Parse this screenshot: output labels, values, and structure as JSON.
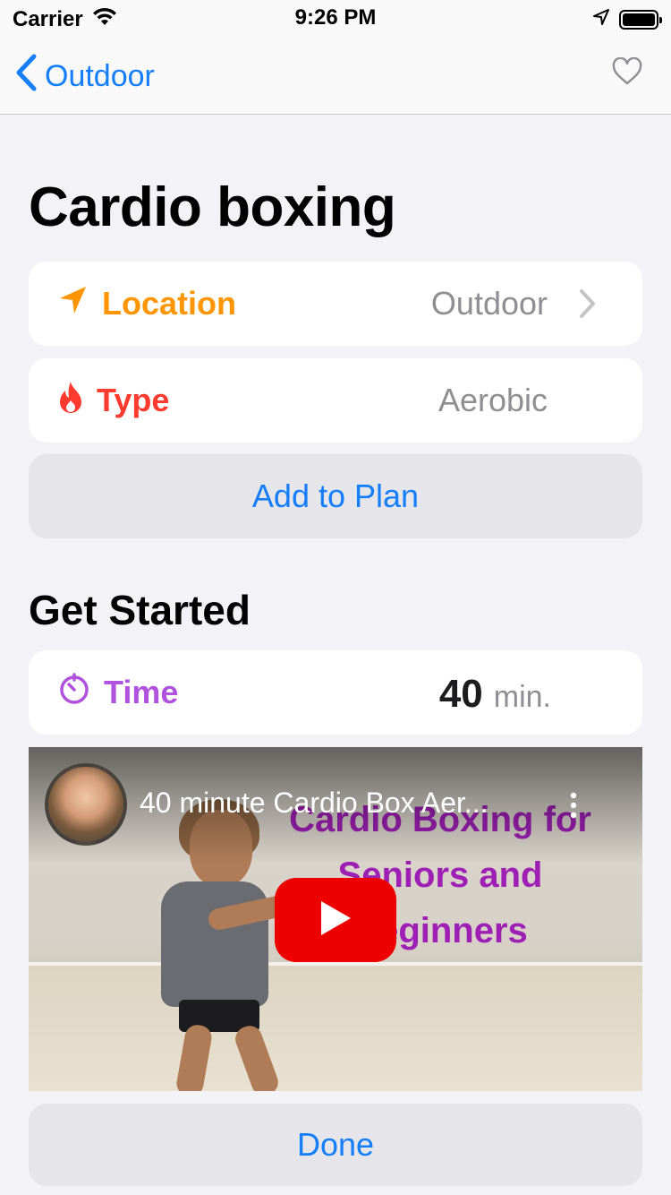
{
  "status_bar": {
    "carrier": "Carrier",
    "time": "9:26 PM",
    "icons": [
      "wifi-icon",
      "location-arrow-icon",
      "battery-icon"
    ]
  },
  "nav": {
    "back_label": "Outdoor",
    "back_icon": "chevron-left-icon",
    "favorite_icon": "heart-outline-icon"
  },
  "page": {
    "title": "Cardio boxing"
  },
  "details": {
    "location": {
      "label": "Location",
      "value": "Outdoor",
      "icon": "location-arrow-icon",
      "color": "#ff9500"
    },
    "type": {
      "label": "Type",
      "value": "Aerobic",
      "icon": "flame-icon",
      "color": "#ff3b30"
    }
  },
  "actions": {
    "add_to_plan": "Add to Plan",
    "done": "Done"
  },
  "get_started": {
    "section_title": "Get Started",
    "time": {
      "label": "Time",
      "value": "40",
      "unit": "min.",
      "icon": "timer-icon",
      "color": "#af52de"
    }
  },
  "video": {
    "title": "40 minute Cardio Box Aer...",
    "overlay_text": "Cardio Boxing for Seniors and Beginners",
    "play_icon": "youtube-play-icon"
  },
  "colors": {
    "accent": "#147efb",
    "background": "#f2f2f7"
  }
}
